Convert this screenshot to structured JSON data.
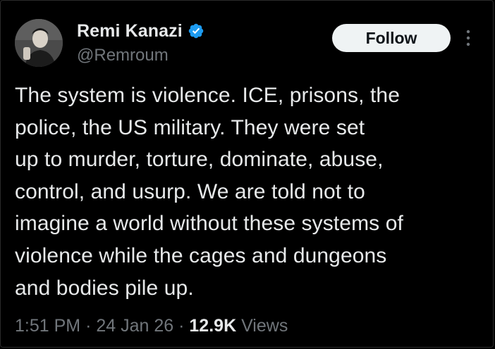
{
  "author": {
    "display_name": "Remi Kanazi",
    "handle": "@Remroum",
    "verified": true,
    "verified_color": "#1d9bf0"
  },
  "actions": {
    "follow_label": "Follow",
    "more_icon": "more-vertical-icon"
  },
  "tweet": {
    "lines": [
      "The system is violence. ICE, prisons, the",
      "police, the US military. They were set",
      "up to murder, torture, dominate, abuse,",
      "control, and usurp. We are told not to",
      "imagine a world without these systems of",
      "violence while the cages and dungeons",
      "and bodies pile up."
    ]
  },
  "meta": {
    "time": "1:51 PM",
    "separator": "·",
    "date": "24 Jan 26",
    "views_count": "12.9K",
    "views_label": "Views"
  },
  "colors": {
    "background": "#000000",
    "text_primary": "#e7e9ea",
    "text_secondary": "#71767b",
    "button_bg": "#eff3f4",
    "button_text": "#0f1419"
  }
}
